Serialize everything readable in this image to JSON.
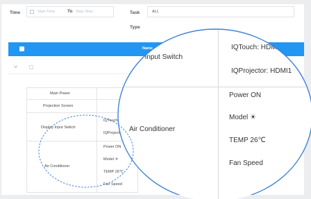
{
  "filter": {
    "time_label": "Time",
    "start_placeholder": "Start Time",
    "to_label": "To",
    "stop_placeholder": "Stop Time",
    "task_label": "Task",
    "task_value": "ALL",
    "type_label": "Type"
  },
  "table": {
    "header_name": "Name",
    "rows": {
      "main_power": "Main Power",
      "projection_screen": "Projection Screen",
      "display_input_switch": "Display Input Switch",
      "air_conditioner": "Air Conditioner"
    },
    "switch_values": [
      "IQTouch: HDMI1",
      "IQProjector: HDMI1"
    ],
    "ac_values": [
      "Power ON",
      "Model ☀",
      "TEMP 26℃",
      "Fan Speed"
    ]
  },
  "magnifier": {
    "switch_label": "Display Input Switch",
    "ac_label": "Air Conditioner",
    "switch_values": [
      "IQTouch: HDMI1",
      "IQProjector: HDMI1"
    ],
    "ac_values": [
      "Power ON",
      "Model ☀",
      "TEMP 26℃",
      "Fan Speed"
    ]
  },
  "colors": {
    "header": "#2196f3",
    "annotation": "#3f83d8"
  }
}
